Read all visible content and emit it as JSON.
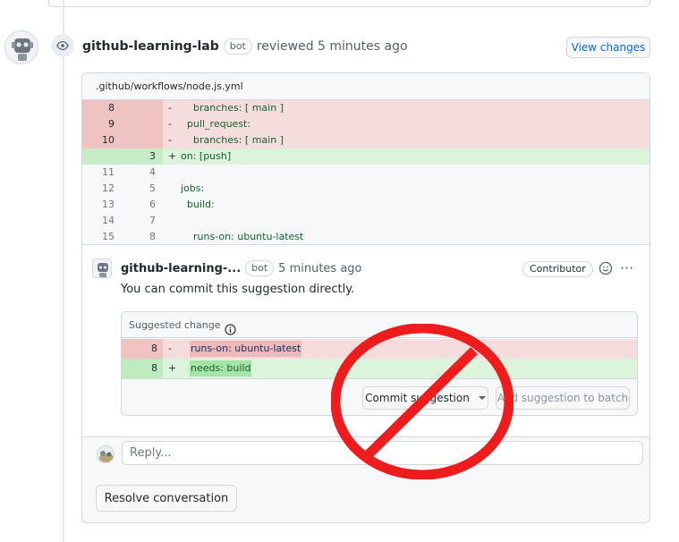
{
  "review": {
    "author": "github-learning-lab",
    "bot_badge": "bot",
    "meta": "reviewed 5 minutes ago",
    "view_changes_label": "View changes"
  },
  "file": {
    "path": ".github/workflows/node.js.yml"
  },
  "diff_lines": [
    {
      "old": "8",
      "new": "",
      "sign": "-",
      "code": "    branches: [ main ]",
      "type": "del"
    },
    {
      "old": "9",
      "new": "",
      "sign": "-",
      "code": "  pull_request:",
      "type": "del"
    },
    {
      "old": "10",
      "new": "",
      "sign": "-",
      "code": "    branches: [ main ]",
      "type": "del"
    },
    {
      "old": "",
      "new": "3",
      "sign": "+",
      "code": "on: [push]",
      "type": "add"
    },
    {
      "old": "11",
      "new": "4",
      "sign": "",
      "code": "",
      "type": "ctx"
    },
    {
      "old": "12",
      "new": "5",
      "sign": "",
      "code": "jobs:",
      "type": "ctx"
    },
    {
      "old": "13",
      "new": "6",
      "sign": "",
      "code": "  build:",
      "type": "ctx"
    },
    {
      "old": "14",
      "new": "7",
      "sign": "",
      "code": "",
      "type": "ctx"
    },
    {
      "old": "15",
      "new": "8",
      "sign": "",
      "code": "    runs-on: ubuntu-latest",
      "type": "ctx"
    }
  ],
  "comment": {
    "author": "github-learning-...",
    "bot_badge": "bot",
    "time": "5 minutes ago",
    "role_badge": "Contributor",
    "body": "You can commit this suggestion directly.",
    "more_label": "···"
  },
  "suggestion": {
    "header": "Suggested change",
    "del_line": {
      "ln": "8",
      "sign": "-",
      "code": "runs-on: ubuntu-latest"
    },
    "add_line": {
      "ln": "8",
      "sign": "+",
      "code": "needs: build"
    },
    "commit_label": "Commit suggestion",
    "batch_label": "Add suggestion to batch"
  },
  "reply": {
    "placeholder": "Reply..."
  },
  "resolve_label": "Resolve conversation",
  "colors": {
    "del_bg": "#f6dcdc",
    "add_bg": "#dcf3dc",
    "link": "#0969da",
    "no_sign": "#ee1c1c"
  },
  "icons": [
    "eye-icon",
    "info-icon",
    "smiley-icon",
    "kebab-icon",
    "caret-down-icon",
    "no-symbol-icon"
  ]
}
